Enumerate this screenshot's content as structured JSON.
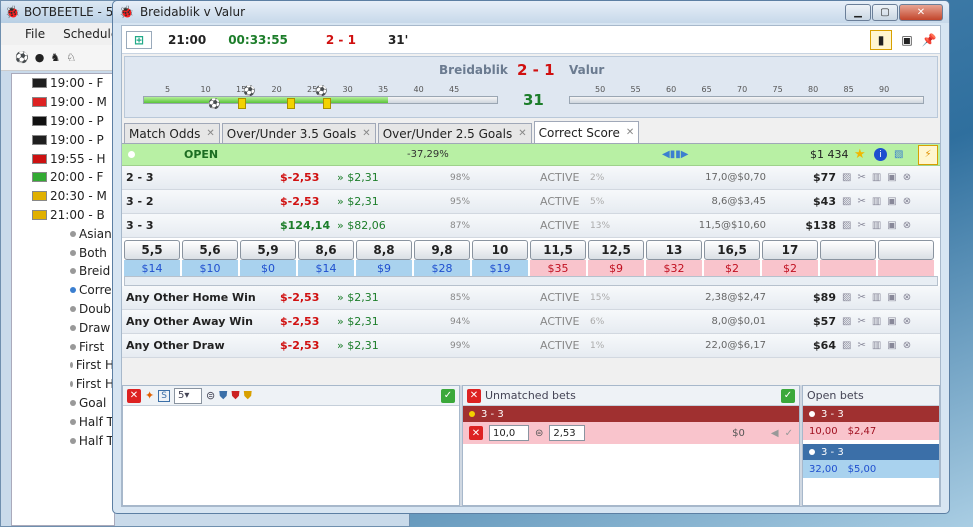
{
  "bg_window": {
    "title": "BOTBEETLE - 5.",
    "menu": [
      "File",
      "Scheduler"
    ],
    "events": [
      {
        "time": "19:00 - F",
        "flag": "#1f1f1f"
      },
      {
        "time": "19:00 - M",
        "flag": "#d22"
      },
      {
        "time": "19:00 - P",
        "flag": "#111"
      },
      {
        "time": "19:00 - P",
        "flag": "#1f1f1f"
      },
      {
        "time": "19:55 - H",
        "flag": "#c11"
      },
      {
        "time": "20:00 - F",
        "flag": "#3a3"
      },
      {
        "time": "20:30 - M",
        "flag": "#e0b000"
      },
      {
        "time": "21:00 - B",
        "flag": "#e0b000"
      }
    ],
    "markets": [
      "Asian",
      "Both",
      "Breid",
      "Corre",
      "Doub",
      "Draw",
      "First",
      "First H",
      "First H",
      "Goal",
      "Half T",
      "Half T"
    ]
  },
  "window": {
    "title": "Breidablik v Valur",
    "start_time": "21:00",
    "elapsed": "00:33:55",
    "score": "2 - 1",
    "minute": "31'"
  },
  "match": {
    "home": "Breidablik",
    "away": "Valur",
    "score": "2 - 1",
    "minute": "31",
    "ticks_first_half": [
      "5",
      "10",
      "15",
      "20",
      "25",
      "30",
      "35",
      "40",
      "45"
    ],
    "ticks_second_half": [
      "50",
      "55",
      "60",
      "65",
      "70",
      "75",
      "80",
      "85",
      "90"
    ],
    "progress_first_half": 0.69
  },
  "tabs": [
    {
      "label": "Match Odds"
    },
    {
      "label": "Over/Under 3.5 Goals"
    },
    {
      "label": "Over/Under 2.5 Goals"
    },
    {
      "label": "Correct Score"
    }
  ],
  "market": {
    "status": "OPEN",
    "overround": "-37,29%",
    "matched": "$1 434"
  },
  "runners_top": [
    {
      "name": "2 - 3",
      "pl": "$-2,53",
      "ex": "» $2,31",
      "pct": "98%",
      "status": "ACTIVE",
      "pct2": "2%",
      "odds": "17,0@$0,70",
      "amt": "$77",
      "pl_color": "#d01010"
    },
    {
      "name": "3 - 2",
      "pl": "$-2,53",
      "ex": "» $2,31",
      "pct": "95%",
      "status": "ACTIVE",
      "pct2": "5%",
      "odds": "8,6@$3,45",
      "amt": "$43",
      "pl_color": "#d01010"
    },
    {
      "name": "3 - 3",
      "pl": "$124,14",
      "ex": "» $82,06",
      "pct": "87%",
      "status": "ACTIVE",
      "pct2": "13%",
      "odds": "11,5@$10,60",
      "amt": "$138",
      "pl_color": "#1c7d2a"
    }
  ],
  "ladder": [
    {
      "price": "5,5",
      "amount": "$14",
      "side": "back"
    },
    {
      "price": "5,6",
      "amount": "$10",
      "side": "back"
    },
    {
      "price": "5,9",
      "amount": "$0",
      "side": "back"
    },
    {
      "price": "8,6",
      "amount": "$14",
      "side": "back"
    },
    {
      "price": "8,8",
      "amount": "$9",
      "side": "back"
    },
    {
      "price": "9,8",
      "amount": "$28",
      "side": "back"
    },
    {
      "price": "10",
      "amount": "$19",
      "side": "back"
    },
    {
      "price": "11,5",
      "amount": "$35",
      "side": "lay"
    },
    {
      "price": "12,5",
      "amount": "$9",
      "side": "lay"
    },
    {
      "price": "13",
      "amount": "$32",
      "side": "lay"
    },
    {
      "price": "16,5",
      "amount": "$2",
      "side": "lay"
    },
    {
      "price": "17",
      "amount": "$2",
      "side": "lay"
    },
    {
      "price": "",
      "amount": "",
      "side": "lay"
    },
    {
      "price": "",
      "amount": "",
      "side": "lay"
    }
  ],
  "runners_bottom": [
    {
      "name": "Any Other Home Win",
      "pl": "$-2,53",
      "ex": "» $2,31",
      "pct": "85%",
      "status": "ACTIVE",
      "pct2": "15%",
      "odds": "2,38@$2,47",
      "amt": "$89",
      "pl_color": "#d01010"
    },
    {
      "name": "Any Other Away Win",
      "pl": "$-2,53",
      "ex": "» $2,31",
      "pct": "94%",
      "status": "ACTIVE",
      "pct2": "6%",
      "odds": "8,0@$0,01",
      "amt": "$57",
      "pl_color": "#d01010"
    },
    {
      "name": "Any Other Draw",
      "pl": "$-2,53",
      "ex": "» $2,31",
      "pct": "99%",
      "status": "ACTIVE",
      "pct2": "1%",
      "odds": "22,0@$6,17",
      "amt": "$64",
      "pl_color": "#d01010"
    }
  ],
  "bet_panel": {
    "stake_select": "5"
  },
  "unmatched": {
    "title": "Unmatched bets",
    "bet": {
      "selection": "3 - 3",
      "odds": "10,0",
      "stake": "2,53",
      "matched": "$0"
    }
  },
  "open_bets": {
    "title": "Open bets",
    "bets": [
      {
        "selection": "3 - 3",
        "odds": "10,00",
        "stake": "$2,47",
        "side": "lay"
      },
      {
        "selection": "3 - 3",
        "odds": "32,00",
        "stake": "$5,00",
        "side": "back"
      }
    ]
  },
  "colors": {
    "back": "#a9d2ee",
    "lay": "#f9c4cc",
    "open": "#b8f0a4"
  }
}
